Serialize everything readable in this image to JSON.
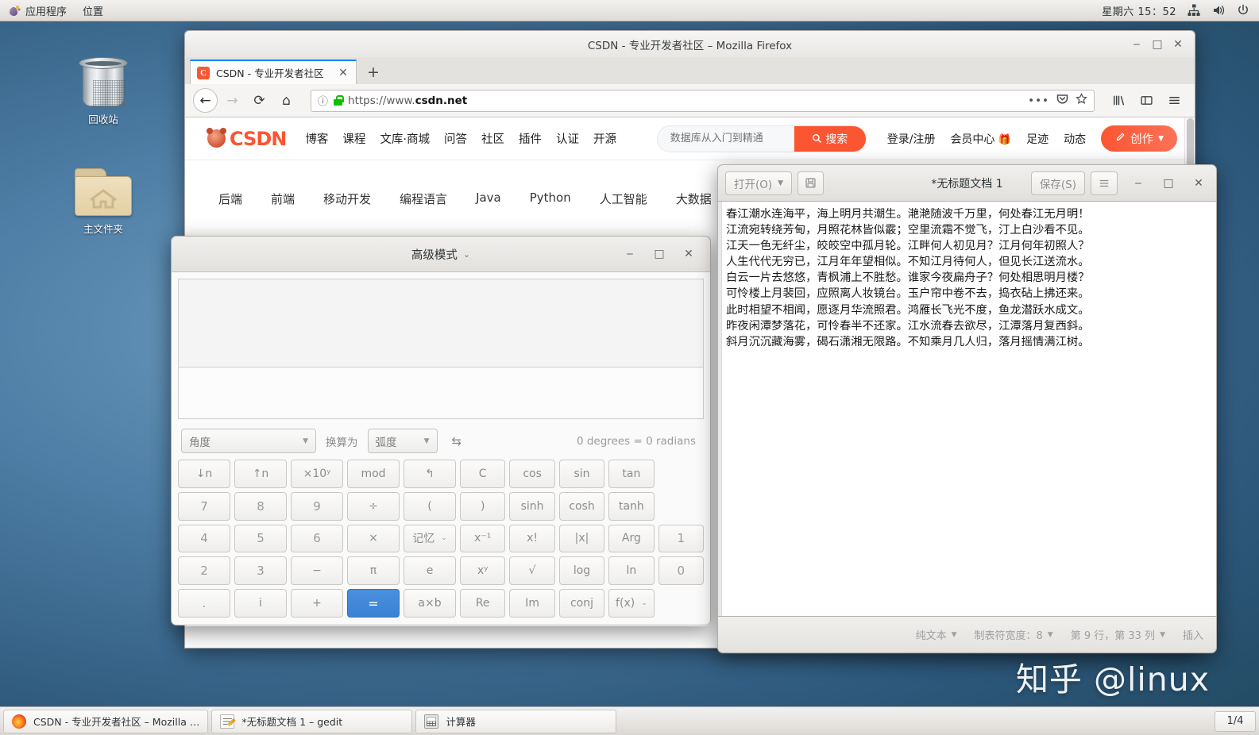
{
  "top_panel": {
    "applications_label": "应用程序",
    "places_label": "位置",
    "clock": "星期六 15：52",
    "icons": [
      "network-icon",
      "volume-icon",
      "power-icon"
    ]
  },
  "desktop": {
    "icons": [
      {
        "name": "trash",
        "label": "回收站"
      },
      {
        "name": "home-folder",
        "label": "主文件夹"
      }
    ],
    "watermark": "知乎 @linux"
  },
  "firefox": {
    "window_title": "CSDN - 专业开发者社区  –  Mozilla Firefox",
    "tab": {
      "favicon_letter": "C",
      "title": "CSDN - 专业开发者社区",
      "close": "✕"
    },
    "new_tab": "+",
    "nav": {
      "back": "←",
      "forward": "→",
      "reload": "⟳",
      "home": "⌂"
    },
    "urlbar": {
      "info_icon": "ⓘ",
      "lock_icon": "lock-icon",
      "scheme": "https://www.",
      "domain": "csdn.net",
      "full_url": "https://www.csdn.net",
      "page_actions": "•••",
      "pocket_icon": "pocket-icon",
      "bookmark_icon": "★"
    },
    "toolbar_right": [
      "library-icon",
      "sidebar-icon",
      "menu-icon"
    ],
    "window_buttons": {
      "minimize": "‒",
      "maximize": "□",
      "close": "✕"
    },
    "page": {
      "logo_text": "CSDN",
      "nav_items": [
        "博客",
        "课程",
        "文库·商城",
        "问答",
        "社区",
        "插件",
        "认证",
        "开源"
      ],
      "search_placeholder": "数据库从入门到精通",
      "search_button": "搜索",
      "user_links": [
        "登录/注册",
        "会员中心",
        "足迹",
        "动态"
      ],
      "create_button": "创作",
      "categories": [
        "后端",
        "前端",
        "移动开发",
        "编程语言",
        "Java",
        "Python",
        "人工智能",
        "大数据"
      ]
    }
  },
  "calculator": {
    "title": "高级模式",
    "window_buttons": {
      "minimize": "‒",
      "maximize": "□",
      "close": "✕"
    },
    "display_value": "",
    "entry_value": "",
    "conversion": {
      "from_label": "角度",
      "convert_to_label": "换算为",
      "to_label": "弧度",
      "swap_icon": "swap-icon",
      "result": "0 degrees = 0 radians"
    },
    "keys": [
      {
        "label": "↓n",
        "name": "subscript-key"
      },
      {
        "label": "↑n",
        "name": "superscript-key"
      },
      {
        "label": "×10ʸ",
        "name": "exponent-key"
      },
      {
        "label": "mod",
        "name": "modulus-key"
      },
      {
        "label": "↰",
        "name": "undo-key"
      },
      {
        "label": "C",
        "name": "clear-key"
      },
      {
        "label": "cos",
        "name": "cos-key"
      },
      {
        "label": "sin",
        "name": "sin-key"
      },
      {
        "label": "tan",
        "name": "tan-key"
      },
      {
        "label": "7",
        "name": "digit-7-key"
      },
      {
        "label": "8",
        "name": "digit-8-key"
      },
      {
        "label": "9",
        "name": "digit-9-key"
      },
      {
        "label": "÷",
        "name": "divide-key"
      },
      {
        "label": "(",
        "name": "open-paren-key"
      },
      {
        "label": ")",
        "name": "close-paren-key"
      },
      {
        "label": "sinh",
        "name": "sinh-key"
      },
      {
        "label": "cosh",
        "name": "cosh-key"
      },
      {
        "label": "tanh",
        "name": "tanh-key"
      },
      {
        "label": "4",
        "name": "digit-4-key"
      },
      {
        "label": "5",
        "name": "digit-5-key"
      },
      {
        "label": "6",
        "name": "digit-6-key"
      },
      {
        "label": "×",
        "name": "multiply-key"
      },
      {
        "label": "记忆",
        "name": "memory-key",
        "caret": true
      },
      {
        "label": "x⁻¹",
        "name": "inverse-key"
      },
      {
        "label": "x!",
        "name": "factorial-key"
      },
      {
        "label": "|x|",
        "name": "absolute-key"
      },
      {
        "label": "Arg",
        "name": "argument-key"
      },
      {
        "label": "1",
        "name": "digit-1-key"
      },
      {
        "label": "2",
        "name": "digit-2-key"
      },
      {
        "label": "3",
        "name": "digit-3-key"
      },
      {
        "label": "−",
        "name": "subtract-key"
      },
      {
        "label": "π",
        "name": "pi-key"
      },
      {
        "label": "e",
        "name": "euler-key"
      },
      {
        "label": "xʸ",
        "name": "power-key"
      },
      {
        "label": "√",
        "name": "square-root-key"
      },
      {
        "label": "log",
        "name": "log-key"
      },
      {
        "label": "ln",
        "name": "ln-key"
      },
      {
        "label": "0",
        "name": "digit-0-key"
      },
      {
        "label": ".",
        "name": "decimal-point-key"
      },
      {
        "label": "i",
        "name": "imaginary-key"
      },
      {
        "label": "+",
        "name": "add-key"
      },
      {
        "label": "=",
        "name": "equals-key"
      },
      {
        "label": "a×b",
        "name": "complex-multiply-key"
      },
      {
        "label": "Re",
        "name": "real-part-key"
      },
      {
        "label": "Im",
        "name": "imaginary-part-key"
      },
      {
        "label": "conj",
        "name": "conjugate-key"
      },
      {
        "label": "f(x)",
        "name": "function-key",
        "caret": true
      }
    ]
  },
  "gedit": {
    "open_button": "打开(O)",
    "open_caret": "▾",
    "save_as_icon": "save-as-icon",
    "title": "*无标题文档 1",
    "save_button": "保存(S)",
    "menu_icon": "hamburger-icon",
    "window_buttons": {
      "minimize": "‒",
      "maximize": "□",
      "close": "✕"
    },
    "document_lines": [
      "春江潮水连海平，海上明月共潮生。滟滟随波千万里，何处春江无月明！",
      "江流宛转绕芳甸，月照花林皆似霰；空里流霜不觉飞，汀上白沙看不见。",
      "江天一色无纤尘，皎皎空中孤月轮。江畔何人初见月？江月何年初照人？",
      "人生代代无穷已，江月年年望相似。不知江月待何人，但见长江送流水。",
      "白云一片去悠悠，青枫浦上不胜愁。谁家今夜扁舟子？何处相思明月楼？",
      "可怜楼上月裴回，应照离人妆镜台。玉户帘中卷不去，捣衣砧上拂还来。",
      "此时相望不相闻，愿逐月华流照君。鸿雁长飞光不度，鱼龙潜跃水成文。",
      "昨夜闲潭梦落花，可怜春半不还家。江水流春去欲尽，江潭落月复西斜。",
      "斜月沉沉藏海雾，碣石潇湘无限路。不知乘月几人归，落月摇情满江树。"
    ],
    "status": {
      "file_type": "纯文本",
      "tab_width": "制表符宽度：8",
      "cursor_position": "第 9 行，第 33 列",
      "insert_mode": "插入",
      "caret": "▾"
    }
  },
  "taskbar": {
    "tasks": [
      {
        "icon": "firefox-icon",
        "label": "CSDN - 专业开发者社区 – Mozilla …"
      },
      {
        "icon": "gedit-icon",
        "label": "*无标题文档 1 – gedit"
      },
      {
        "icon": "calculator-icon",
        "label": "计算器"
      }
    ],
    "workspace": "1/4"
  }
}
